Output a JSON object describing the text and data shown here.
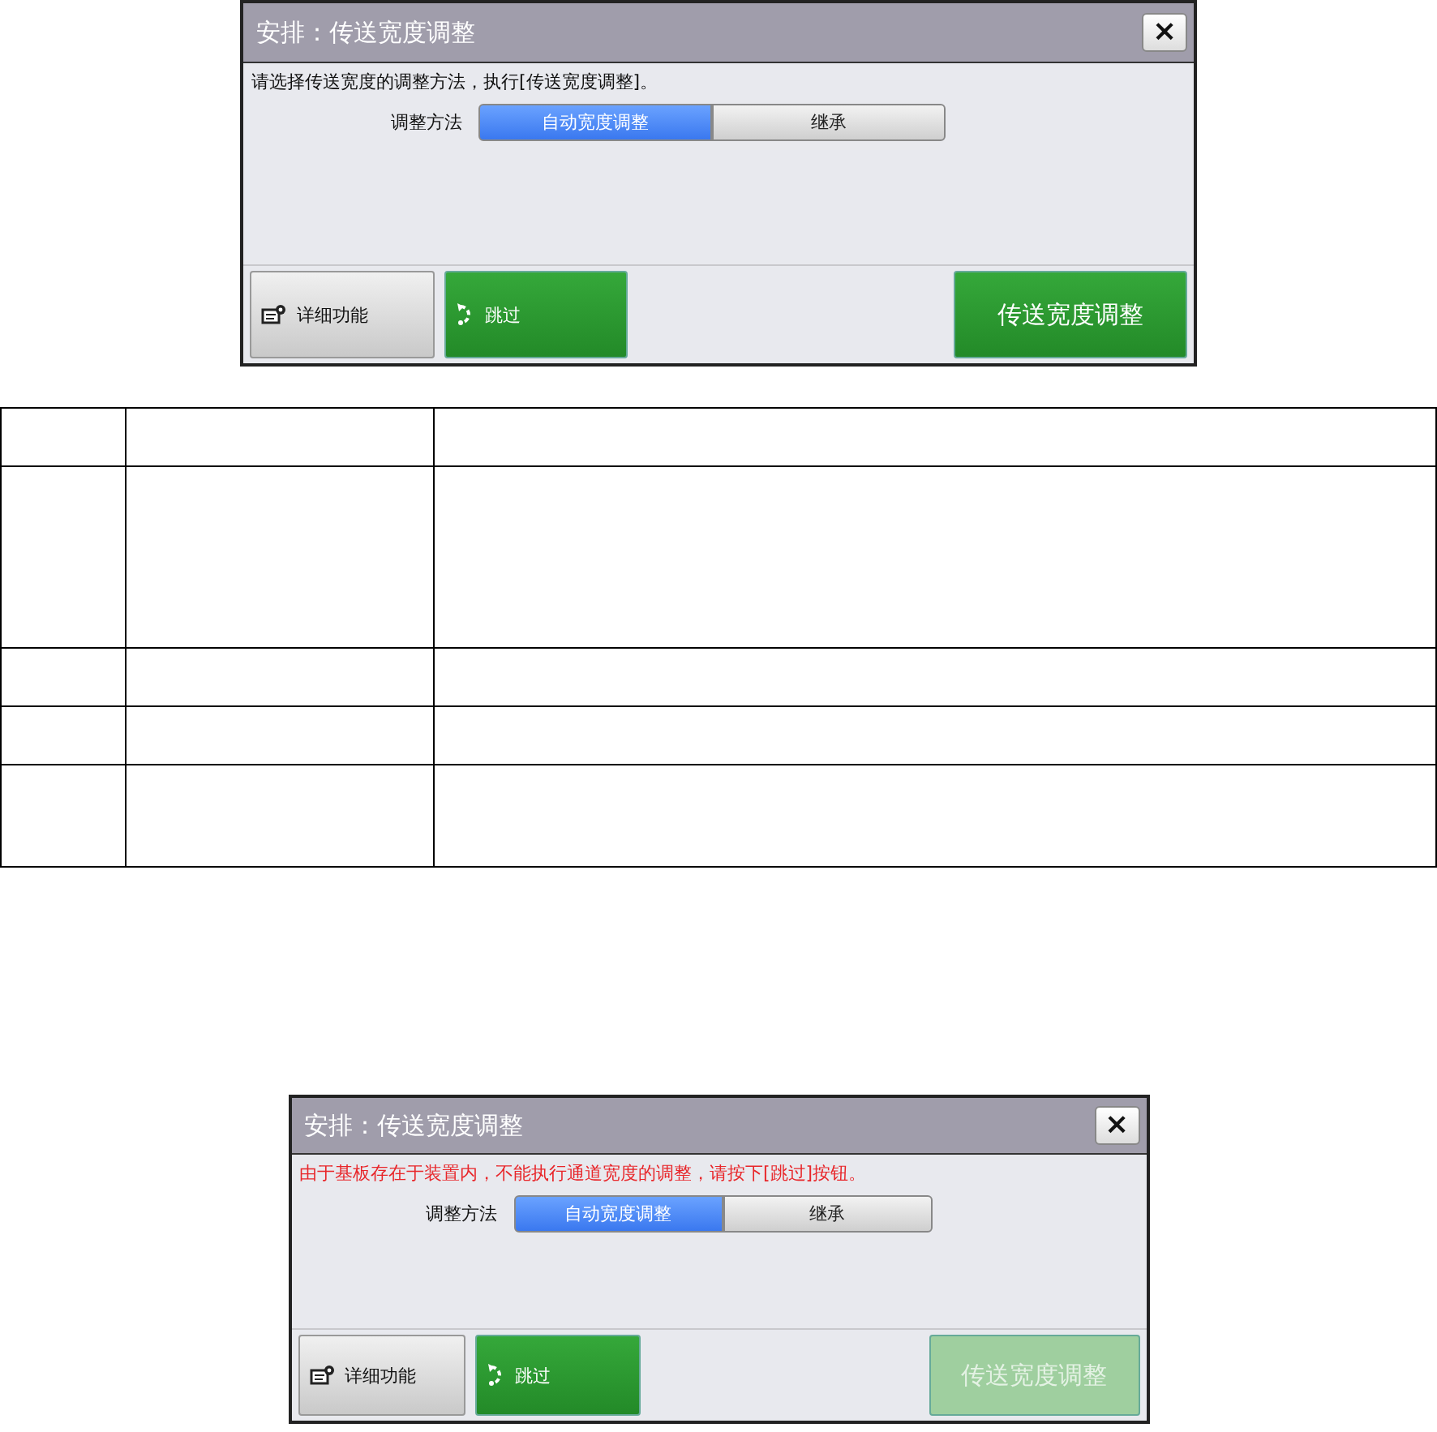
{
  "dialogs": [
    {
      "title": "安排：传送宽度调整",
      "close": "×",
      "message": {
        "text": "请选择传送宽度的调整方法，执行[传送宽度调整]。",
        "kind": "info"
      },
      "method_label": "调整方法",
      "options": [
        {
          "label": "自动宽度调整",
          "selected": true
        },
        {
          "label": "继承",
          "selected": false
        }
      ],
      "buttons": [
        {
          "label": "详细功能",
          "kind": "details",
          "disabled": false
        },
        {
          "label": "跳过",
          "kind": "skip",
          "disabled": false
        },
        {
          "label": "传送宽度调整",
          "kind": "primary",
          "disabled": false
        }
      ]
    },
    {
      "title": "安排：传送宽度调整",
      "close": "×",
      "message": {
        "text": "由于基板存在于装置内，不能执行通道宽度的调整，请按下[跳过]按钮。",
        "kind": "error"
      },
      "method_label": "调整方法",
      "options": [
        {
          "label": "自动宽度调整",
          "selected": true
        },
        {
          "label": "继承",
          "selected": false
        }
      ],
      "buttons": [
        {
          "label": "详细功能",
          "kind": "details",
          "disabled": false
        },
        {
          "label": "跳过",
          "kind": "skip",
          "disabled": false
        },
        {
          "label": "传送宽度调整",
          "kind": "primary",
          "disabled": true
        }
      ]
    }
  ]
}
